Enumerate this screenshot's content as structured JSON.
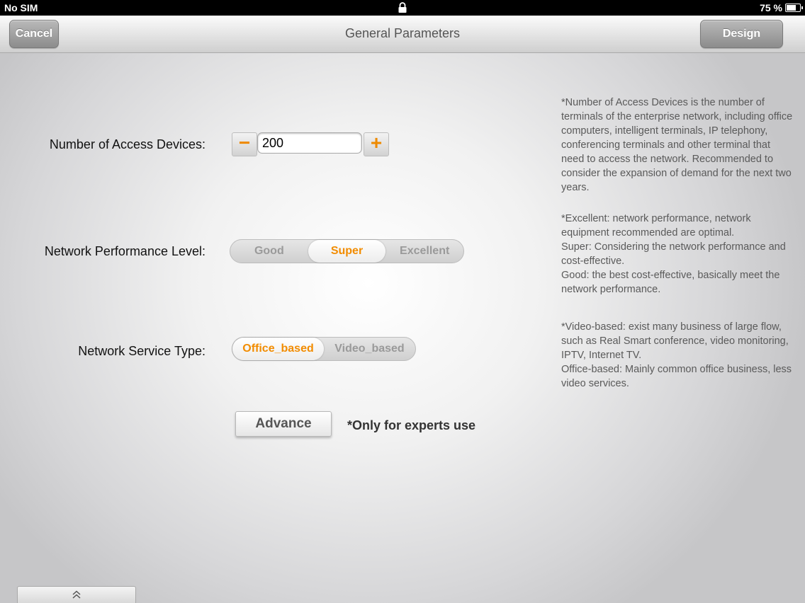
{
  "status": {
    "carrier": "No SIM",
    "battery": "75 %",
    "battery_level": 0.75
  },
  "nav": {
    "title": "General Parameters",
    "cancel_label": "Cancel",
    "design_label": "Design"
  },
  "access_devices": {
    "label": "Number of Access Devices:",
    "value": "200",
    "minus": "−",
    "plus": "+"
  },
  "performance": {
    "label": "Network Performance Level:",
    "options": [
      "Good",
      "Super",
      "Excellent"
    ],
    "selected": "Super"
  },
  "service_type": {
    "label": "Network Service Type:",
    "options": [
      "Office_based",
      "Video_based"
    ],
    "selected": "Office_based"
  },
  "advance": {
    "label": "Advance",
    "note": "*Only for experts use"
  },
  "help": {
    "access_devices": "*Number of Access Devices is the number of terminals of the enterprise network, including office computers, intelligent terminals, IP telephony, conferencing terminals and other terminal that need to access the network. Recommended to consider the expansion of demand for the next two years.",
    "performance": "*Excellent: network performance, network equipment recommended are optimal.\nSuper: Considering the network performance and cost-effective.\nGood: the best cost-effective, basically meet the network performance.",
    "service_type": "*Video-based: exist many business of large flow, such as Real Smart conference, video monitoring, IPTV, Internet TV.\nOffice-based: Mainly common office business, less video services."
  },
  "colors": {
    "accent": "#f28c00",
    "nav_button": "#8c8c8c"
  },
  "icons": {
    "lock": "lock-icon",
    "battery": "battery-icon",
    "expand": "double-chevron-up-icon"
  }
}
